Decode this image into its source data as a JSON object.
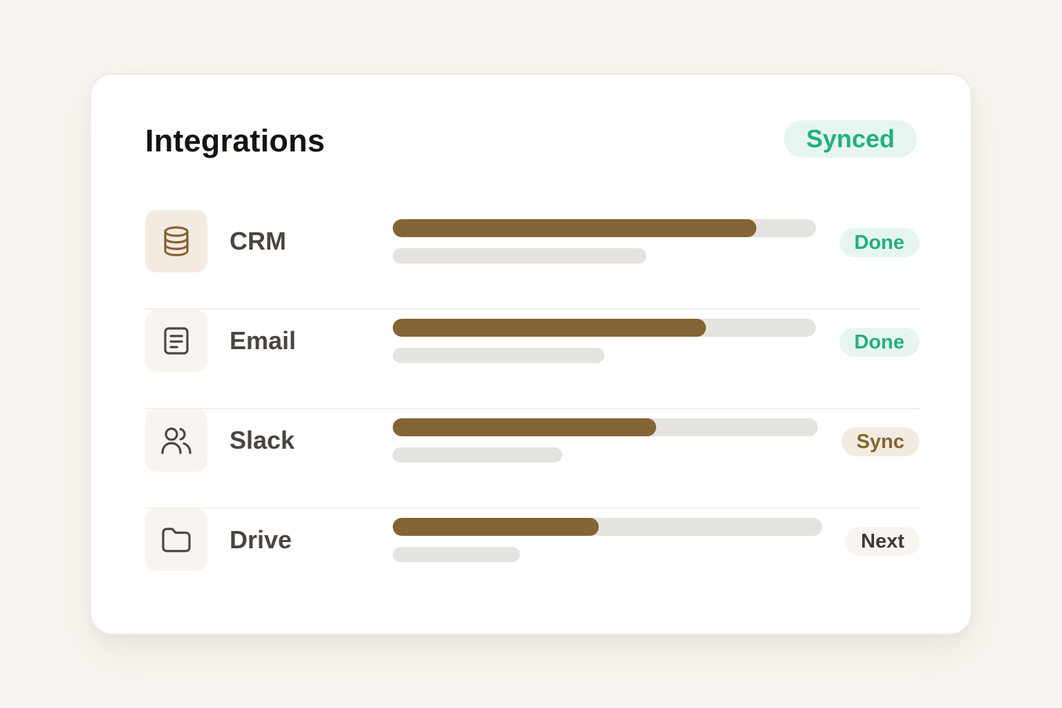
{
  "header": {
    "title": "Integrations",
    "badge": "Synced"
  },
  "colors": {
    "accent": "#846334",
    "success": "#22b07d",
    "success_bg": "#e6f6ef",
    "track": "#e5e3df",
    "background": "#f8f5f0"
  },
  "integrations": [
    {
      "name": "CRM",
      "icon": "database-icon",
      "progress": 0.86,
      "secondary": 0.6,
      "status": "Done"
    },
    {
      "name": "Email",
      "icon": "document-icon",
      "progress": 0.74,
      "secondary": 0.5,
      "status": "Done"
    },
    {
      "name": "Slack",
      "icon": "users-icon",
      "progress": 0.62,
      "secondary": 0.4,
      "status": "Sync"
    },
    {
      "name": "Drive",
      "icon": "folder-icon",
      "progress": 0.48,
      "secondary": 0.3,
      "status": "Next"
    }
  ]
}
